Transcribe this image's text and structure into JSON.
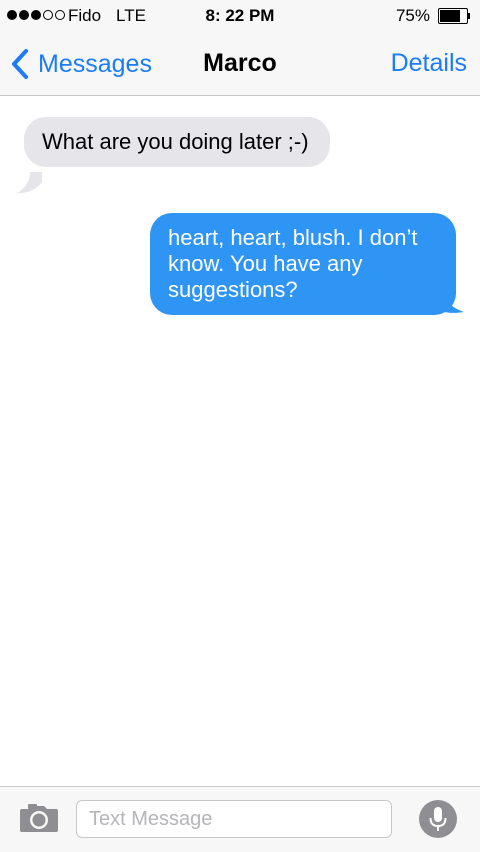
{
  "status_bar": {
    "signal_bars_filled": 3,
    "signal_bars_total": 5,
    "carrier": "Fido",
    "network": "LTE",
    "time": "8: 22 PM",
    "battery_percent": "75%",
    "battery_level": 0.75
  },
  "nav": {
    "back_label": "Messages",
    "title": "Marco",
    "details_label": "Details"
  },
  "messages": [
    {
      "direction": "received",
      "text": "What are you doing later ;-)"
    },
    {
      "direction": "sent",
      "text": "heart, heart, blush. I don’t know. You have any suggestions?"
    }
  ],
  "composer": {
    "placeholder": "Text Message",
    "value": ""
  },
  "icons": {
    "back": "chevron-left-icon",
    "camera": "camera-icon",
    "mic": "microphone-icon"
  },
  "colors": {
    "accent": "#1a7cf6",
    "sent_bubble": "#2f95f4",
    "received_bubble": "#e5e5ea",
    "bar_background": "#f7f7f8",
    "mic_background": "#8e8e93"
  }
}
